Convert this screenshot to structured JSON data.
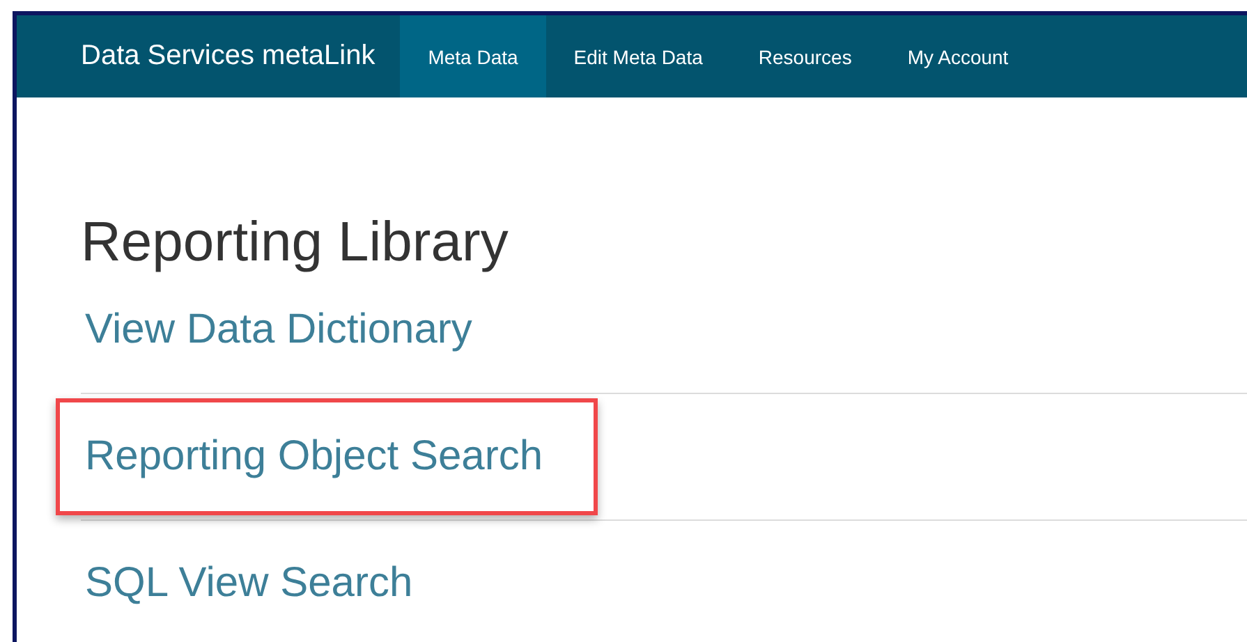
{
  "navbar": {
    "brand": "Data Services metaLink",
    "tabs": [
      {
        "label": "Meta Data",
        "selected": true
      },
      {
        "label": "Edit Meta Data",
        "selected": false
      },
      {
        "label": "Resources",
        "selected": false
      },
      {
        "label": "My Account",
        "selected": false
      }
    ]
  },
  "heading": "Reporting Library",
  "links": [
    {
      "label": "View Data Dictionary",
      "highlighted": false
    },
    {
      "label": "Reporting Object Search",
      "highlighted": true
    },
    {
      "label": "SQL View Search",
      "highlighted": false
    }
  ]
}
